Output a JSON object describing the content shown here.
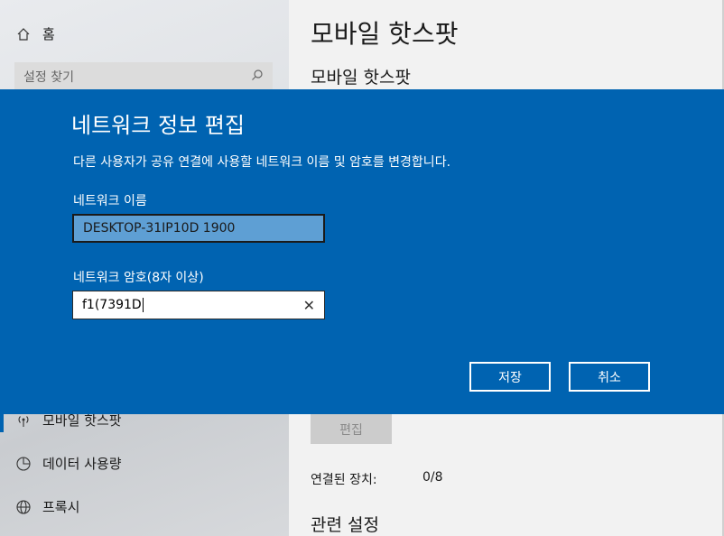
{
  "sidebar": {
    "home_label": "홈",
    "search_placeholder": "설정 찾기",
    "items": [
      {
        "label": "모바일 핫스팟",
        "icon": "hotspot-icon"
      },
      {
        "label": "데이터 사용량",
        "icon": "data-usage-icon"
      },
      {
        "label": "프록시",
        "icon": "globe-icon"
      }
    ]
  },
  "main": {
    "page_title": "모바일 핫스팟",
    "section_title": "모바일 핫스팟",
    "edit_button": "편집",
    "connected_devices_label": "연결된 장치:",
    "connected_devices_value": "0/8",
    "related_settings": "관련 설정"
  },
  "dialog": {
    "title": "네트워크 정보 편집",
    "description": "다른 사용자가 공유 연결에 사용할 네트워크 이름 및 암호를 변경합니다.",
    "network_name_label": "네트워크 이름",
    "network_name_value": "DESKTOP-31IP10D 1900",
    "password_label": "네트워크 암호(8자 이상)",
    "password_value": "f1(7391D",
    "save_button": "저장",
    "cancel_button": "취소"
  },
  "colors": {
    "dialog_bg": "#0063b1",
    "accent": "#0063b1",
    "name_field_bg": "#5e9fd4"
  }
}
